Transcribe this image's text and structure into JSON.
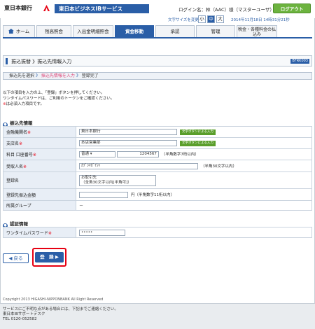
{
  "header": {
    "bank_name": "東日本銀行",
    "service_title": "東日本ビジネスIBサービス",
    "login_info": "ログイン名：林（AAC）様（マスターユーザ）",
    "logout_label": "ログアウト",
    "font_size_label": "文字サイズを変更",
    "font_sizes": [
      "小",
      "中",
      "大"
    ],
    "datetime": "2014年11月18日 14時31分21秒"
  },
  "tabs": [
    "ホーム",
    "残高照会",
    "入出金明細照会",
    "資金移動",
    "承認",
    "管理",
    "税金・各種料金の払込み"
  ],
  "page": {
    "title": "振込振替 》振込先情報入力",
    "code": "BFRK003"
  },
  "steps": {
    "step1": "振込先を選択",
    "step2": "振込先情報を入力",
    "step3": "登録完了"
  },
  "intro": {
    "line1": "以下の項目を入力の上、「登録」ボタンを押してください。",
    "line2": "ワンタイムパスワードは、ご利用のトークンをご確認ください。",
    "line3": "は必須入力項目です。",
    "req_mark": "※"
  },
  "payee": {
    "heading": "振込先情報",
    "rows": {
      "bank_label": "金融機関名",
      "bank_value": "東日本銀行",
      "bank_btn": "文字ボタンによる入力",
      "branch_label": "支店名",
      "branch_value": "本店営業部",
      "branch_btn": "文字ボタンによる入力",
      "account_label": "科目 口座番号",
      "account_type": "普通",
      "account_no": "1204567",
      "account_note": "（半角数字7桁以内）",
      "recipient_label": "受取人名",
      "recipient_value": "ｶﾌﾞｼｷｶﾞｲｼｬ",
      "recipient_note": "（半角30文字以内）",
      "reg_name_label": "登録名",
      "reg_name_value": "お取引先",
      "reg_name_note": "（全角30文字以内[半角可]）",
      "amount_label": "登録先振込金額",
      "amount_note": "円（半角数字11桁以内）",
      "group_label": "所属グループ",
      "group_value": "－"
    }
  },
  "auth": {
    "heading": "認証情報",
    "otp_label": "ワンタイムパスワード",
    "otp_value": "•••••"
  },
  "buttons": {
    "back": "◀ 戻る",
    "register": "登　録 ▶"
  },
  "copyright": "Copyright 2013 HIGASHI-NIPPONBANK All Right Reserved",
  "footer": {
    "line1": "サービスにご不明な点がある場合には、下記までご連絡ください。",
    "line2": "東日本IBサポートデスク",
    "line3": "TEL 0120-052582"
  }
}
